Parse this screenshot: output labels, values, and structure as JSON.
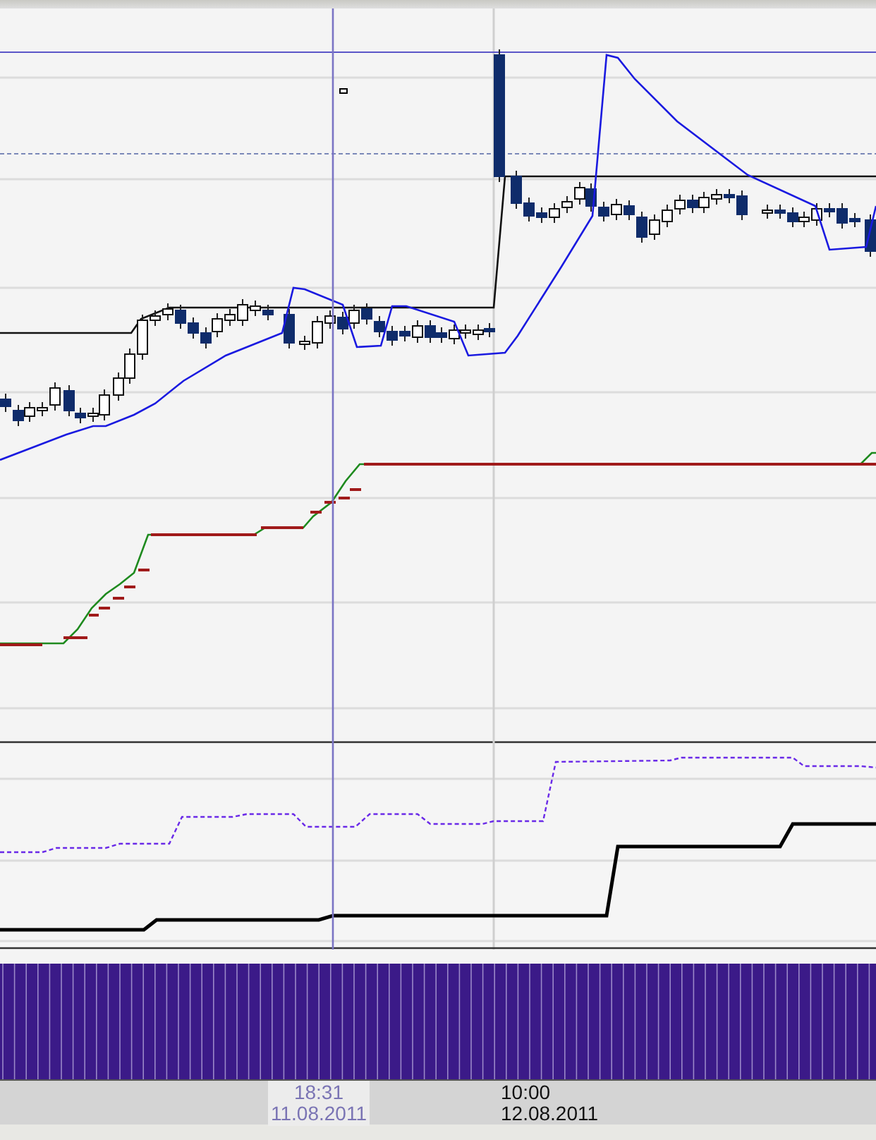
{
  "time_axis": {
    "labels": [
      {
        "kind": "cursor",
        "time": "18:31",
        "date": "11.08.2011"
      },
      {
        "kind": "tick",
        "time": "10:00",
        "date": "12.08.2011"
      }
    ]
  }
}
